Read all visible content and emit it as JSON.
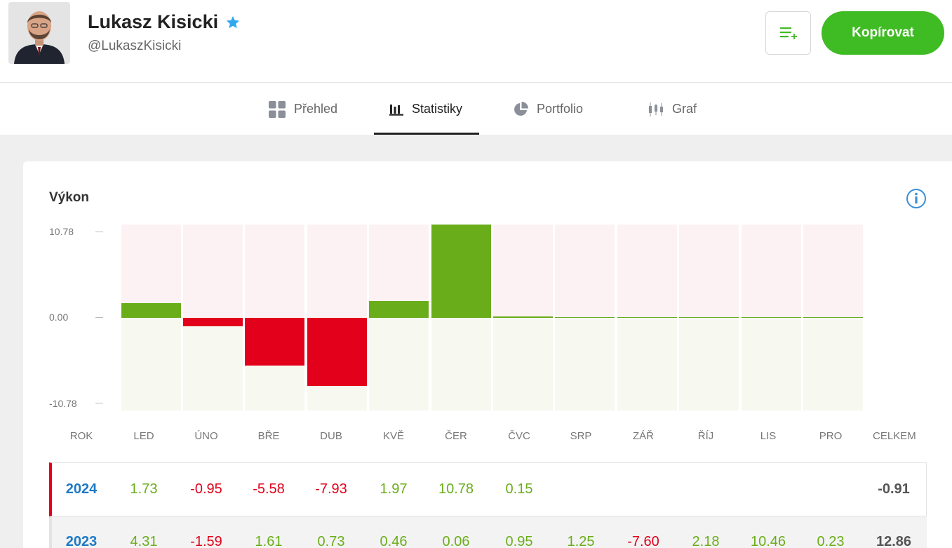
{
  "profile": {
    "name": "Lukasz Kisicki",
    "handle": "@LukaszKisicki",
    "copy_label": "Kopírovat",
    "verified_icon": "star-icon",
    "watch_icon": "watchlist-add-icon"
  },
  "tabs": [
    {
      "label": "Přehled",
      "icon": "grid-icon",
      "active": false
    },
    {
      "label": "Statistiky",
      "icon": "bar-chart-icon",
      "active": true
    },
    {
      "label": "Portfolio",
      "icon": "pie-chart-icon",
      "active": false
    },
    {
      "label": "Graf",
      "icon": "candlestick-icon",
      "active": false
    }
  ],
  "performance": {
    "title": "Výkon",
    "info_icon": "info-icon",
    "table_headers": [
      "ROK",
      "LED",
      "ÚNO",
      "BŘE",
      "DUB",
      "KVĚ",
      "ČER",
      "ČVC",
      "SRP",
      "ZÁŘ",
      "ŘÍJ",
      "LIS",
      "PRO",
      "CELKEM"
    ],
    "rows": [
      {
        "year": "2024",
        "values": [
          "1.73",
          "-0.95",
          "-5.58",
          "-7.93",
          "1.97",
          "10.78",
          "0.15",
          "",
          "",
          "",
          "",
          ""
        ],
        "total": "-0.91"
      },
      {
        "year": "2023",
        "values": [
          "4.31",
          "-1.59",
          "1.61",
          "0.73",
          "0.46",
          "0.06",
          "0.95",
          "1.25",
          "-7.60",
          "2.18",
          "10.46",
          "0.23"
        ],
        "total": "12.86"
      }
    ]
  },
  "chart_data": {
    "type": "bar",
    "title": "Výkon",
    "categories": [
      "LED",
      "ÚNO",
      "BŘE",
      "DUB",
      "KVĚ",
      "ČER",
      "ČVC",
      "SRP",
      "ZÁŘ",
      "ŘÍJ",
      "LIS",
      "PRO"
    ],
    "series": [
      {
        "name": "2024",
        "values": [
          1.73,
          -0.95,
          -5.58,
          -7.93,
          1.97,
          10.78,
          0.15,
          0,
          0,
          0,
          0,
          0
        ]
      }
    ],
    "y_tick_labels": [
      "10.78",
      "0.00",
      "-10.78"
    ],
    "ylim": [
      -10.78,
      10.78
    ],
    "colors": {
      "positive": "#6aad1a",
      "negative": "#e2001a",
      "upper_bg": "#fdf2f3",
      "lower_bg": "#f7f9f0"
    }
  }
}
